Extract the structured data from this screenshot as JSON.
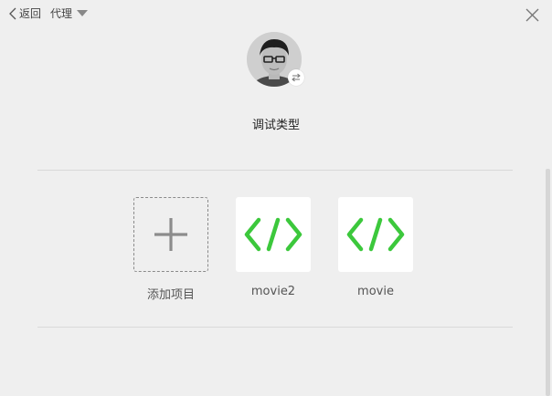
{
  "header": {
    "back_label": "返回",
    "mode_label": "代理"
  },
  "profile": {
    "title": "调试类型"
  },
  "projects": [
    {
      "label": "添加项目",
      "icon": "plus-icon"
    },
    {
      "label": "movie2",
      "icon": "code-icon"
    },
    {
      "label": "movie",
      "icon": "code-icon"
    }
  ],
  "colors": {
    "accent": "#3cc83c",
    "background": "#efefef"
  }
}
